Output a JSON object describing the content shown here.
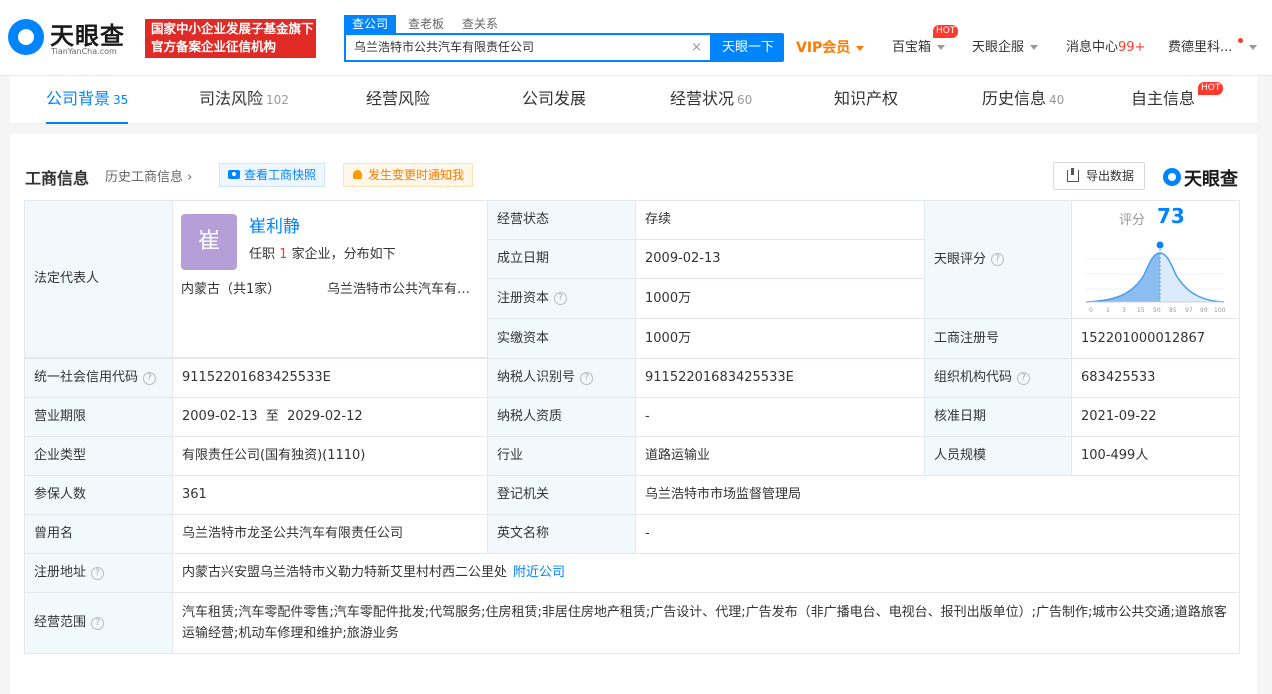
{
  "header": {
    "logo_name": "天眼查",
    "logo_domain": "TianYanCha.com",
    "badge_line1": "国家中小企业发展子基金旗下",
    "badge_line2": "官方备案企业征信机构",
    "search_tabs": [
      "查公司",
      "查老板",
      "查关系"
    ],
    "search_value": "乌兰浩特市公共汽车有限责任公司",
    "search_clear": "×",
    "search_button": "天眼一下",
    "vip": "VIP会员",
    "baibaoxiang": "百宝箱",
    "hot": "HOT",
    "qiye": "天眼企服",
    "msg": "消息中心",
    "msg_count": "99+",
    "user": "费德里科..."
  },
  "nav": {
    "tabs": [
      {
        "label": "公司背景",
        "count": "35"
      },
      {
        "label": "司法风险",
        "count": "102"
      },
      {
        "label": "经营风险",
        "count": ""
      },
      {
        "label": "公司发展",
        "count": ""
      },
      {
        "label": "经营状况",
        "count": "60"
      },
      {
        "label": "知识产权",
        "count": ""
      },
      {
        "label": "历史信息",
        "count": "40"
      },
      {
        "label": "自主信息",
        "count": ""
      }
    ],
    "hot": "HOT"
  },
  "section": {
    "title": "工商信息",
    "history": "历史工商信息",
    "snapshot_btn": "查看工商快照",
    "notify_btn": "发生变更时通知我",
    "export_btn": "导出数据",
    "watermark": "天眼查"
  },
  "legal": {
    "label": "法定代表人",
    "avatar": "崔",
    "name": "崔利静",
    "desc_pre": "任职",
    "desc_num": "1",
    "desc_post": "家企业，分布如下",
    "region": "内蒙古（共1家）",
    "company": "乌兰浩特市公共汽车有限责任公司"
  },
  "score": {
    "label": "天眼评分",
    "title": "评分",
    "value": 73,
    "axis": [
      "0",
      "1",
      "3",
      "15",
      "50",
      "85",
      "97",
      "99",
      "100"
    ]
  },
  "fields": {
    "status_l": "经营状态",
    "status_v": "存续",
    "found_l": "成立日期",
    "found_v": "2009-02-13",
    "regcap_l": "注册资本",
    "regcap_v": "1000万",
    "paidcap_l": "实缴资本",
    "paidcap_v": "1000万",
    "regno_l": "工商注册号",
    "regno_v": "152201000012867",
    "credit_l": "统一社会信用代码",
    "credit_v": "91152201683425533E",
    "taxid_l": "纳税人识别号",
    "taxid_v": "91152201683425533E",
    "org_l": "组织机构代码",
    "org_v": "683425533",
    "term_l": "营业期限",
    "term_v": "2009-02-13  至  2029-02-12",
    "taxq_l": "纳税人资质",
    "taxq_v": "-",
    "appr_l": "核准日期",
    "appr_v": "2021-09-22",
    "type_l": "企业类型",
    "type_v": "有限责任公司(国有独资)(1110)",
    "ind_l": "行业",
    "ind_v": "道路运输业",
    "size_l": "人员规模",
    "size_v": "100-499人",
    "ins_l": "参保人数",
    "ins_v": "361",
    "auth_l": "登记机关",
    "auth_v": "乌兰浩特市市场监督管理局",
    "former_l": "曾用名",
    "former_v": "乌兰浩特市龙圣公共汽车有限责任公司",
    "en_l": "英文名称",
    "en_v": "-",
    "addr_l": "注册地址",
    "addr_v": "内蒙古兴安盟乌兰浩特市义勒力特新艾里村村西二公里处",
    "addr_link": "附近公司",
    "scope_l": "经营范围",
    "scope_v": "汽车租赁;汽车零配件零售;汽车零配件批发;代驾服务;住房租赁;非居住房地产租赁;广告设计、代理;广告发布（非广播电台、电视台、报刊出版单位）;广告制作;城市公共交通;道路旅客运输经营;机动车修理和维护;旅游业务"
  }
}
